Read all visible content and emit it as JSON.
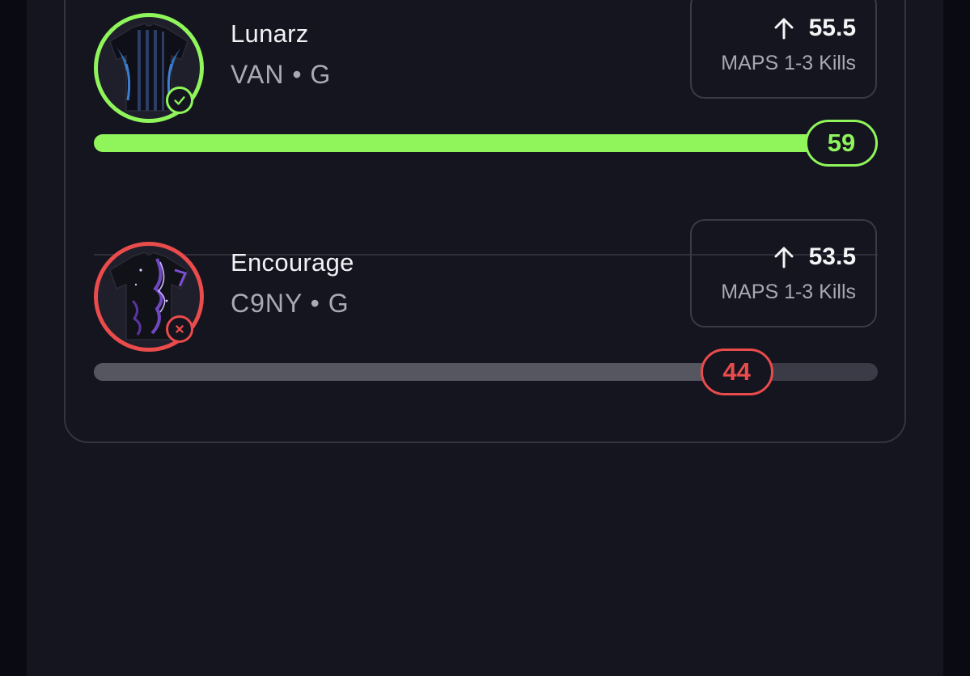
{
  "picks": [
    {
      "name": "Lunarz",
      "team": "VAN",
      "separator": "•",
      "position": "G",
      "result": "win",
      "direction_icon": "arrow-up-icon",
      "line": "55.5",
      "stat_label": "MAPS 1-3 Kills",
      "actual": "59",
      "progress_fraction": 1.0,
      "accent": "#8ff55a",
      "jersey_colors": [
        "#1a2a4a",
        "#2f6fb3",
        "#0c0c14"
      ]
    },
    {
      "name": "Encourage",
      "team": "C9NY",
      "separator": "•",
      "position": "G",
      "result": "loss",
      "direction_icon": "arrow-up-icon",
      "line": "53.5",
      "stat_label": "MAPS 1-3 Kills",
      "actual": "44",
      "progress_fraction": 0.82,
      "accent": "#ea4b4b",
      "jersey_colors": [
        "#111118",
        "#7a4fd1",
        "#c7b6ff"
      ]
    }
  ]
}
